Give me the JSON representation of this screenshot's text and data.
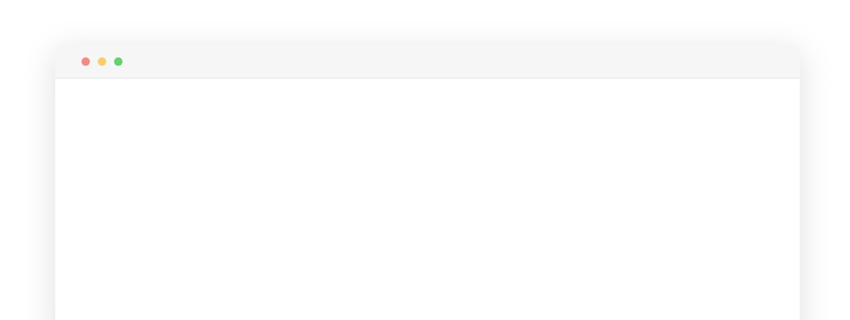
{
  "window": {
    "controls": [
      {
        "color": "#f38a84"
      },
      {
        "color": "#f8ce6b"
      },
      {
        "color": "#63d16f"
      }
    ]
  }
}
